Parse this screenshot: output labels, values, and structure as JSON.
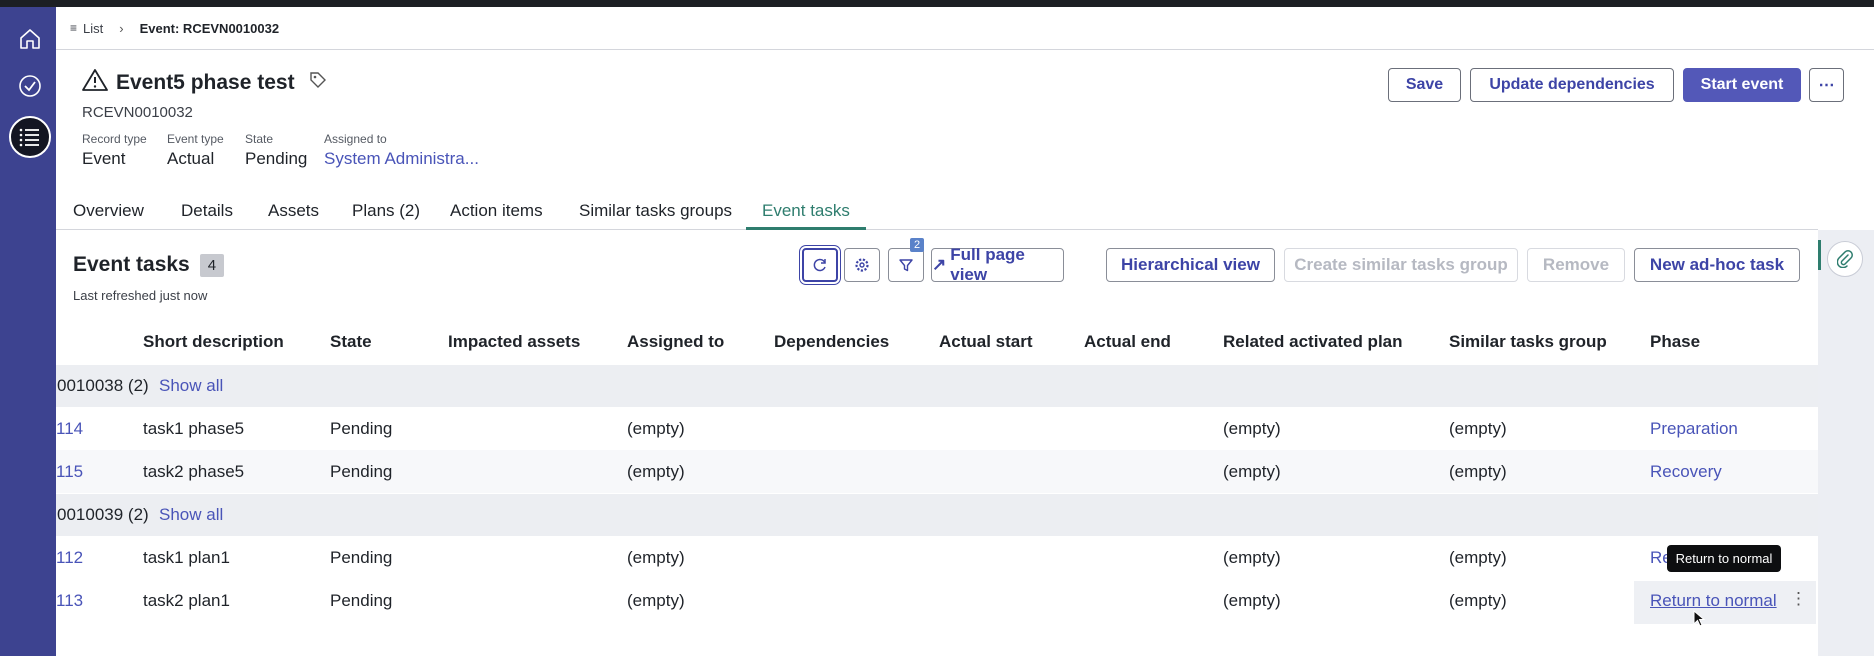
{
  "breadcrumb": {
    "list_label": "List",
    "current": "Event: RCEVN0010032"
  },
  "record": {
    "title": "Event5 phase test",
    "number": "RCEVN0010032",
    "meta": [
      {
        "label": "Record type",
        "value": "Event"
      },
      {
        "label": "Event type",
        "value": "Actual"
      },
      {
        "label": "State",
        "value": "Pending"
      },
      {
        "label": "Assigned to",
        "value": "System Administra..."
      }
    ]
  },
  "header_actions": {
    "save": "Save",
    "update": "Update dependencies",
    "start": "Start event",
    "more": "⋯"
  },
  "tabs": [
    "Overview",
    "Details",
    "Assets",
    "Plans (2)",
    "Action items",
    "Similar tasks groups",
    "Event tasks"
  ],
  "section": {
    "title": "Event tasks",
    "count": "4",
    "refreshed": "Last refreshed just now",
    "filter_badge": "2",
    "buttons": {
      "full_page": "Full page view",
      "hierarchical": "Hierarchical view",
      "create_group": "Create similar tasks group",
      "remove": "Remove",
      "new_task": "New ad-hoc task"
    }
  },
  "table": {
    "columns": [
      "Short description",
      "State",
      "Impacted assets",
      "Assigned to",
      "Dependencies",
      "Actual start",
      "Actual end",
      "Related activated plan",
      "Similar tasks group",
      "Phase"
    ],
    "groups": [
      {
        "label": "0010038 (2)",
        "show_all": "Show all",
        "rows": [
          {
            "num": "114",
            "desc": "task1 phase5",
            "state": "Pending",
            "assigned": "(empty)",
            "plan": "(empty)",
            "group": "(empty)",
            "phase": "Preparation"
          },
          {
            "num": "115",
            "desc": "task2 phase5",
            "state": "Pending",
            "assigned": "(empty)",
            "plan": "(empty)",
            "group": "(empty)",
            "phase": "Recovery"
          }
        ]
      },
      {
        "label": "0010039 (2)",
        "show_all": "Show all",
        "rows": [
          {
            "num": "112",
            "desc": "task1 plan1",
            "state": "Pending",
            "assigned": "(empty)",
            "plan": "(empty)",
            "group": "(empty)",
            "phase": "Re"
          },
          {
            "num": "113",
            "desc": "task2 plan1",
            "state": "Pending",
            "assigned": "(empty)",
            "plan": "(empty)",
            "group": "(empty)",
            "phase": "Return to normal"
          }
        ]
      }
    ]
  },
  "tooltip": "Return to normal",
  "colors": {
    "nav": "#3d4390",
    "primary": "#5358b8",
    "link": "#4954b8",
    "active_tab": "#2e7d6e"
  }
}
